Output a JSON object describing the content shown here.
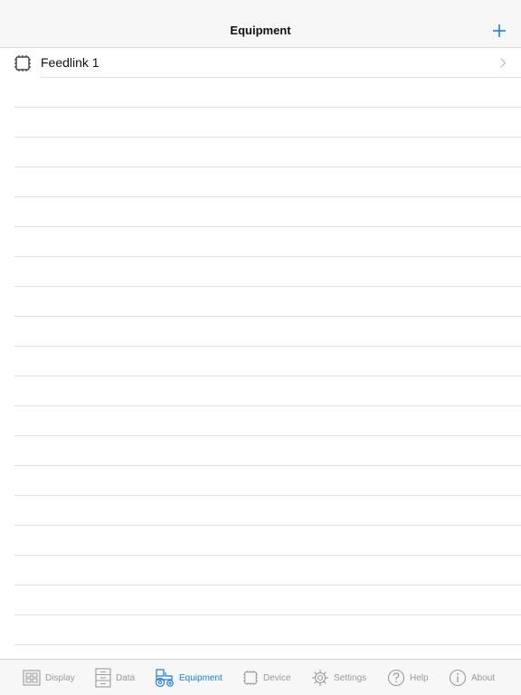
{
  "header": {
    "title": "Equipment"
  },
  "list": {
    "items": [
      {
        "label": "Feedlink 1"
      }
    ],
    "empty_row_count": 19
  },
  "tabs": [
    {
      "label": "Display",
      "icon": "display-icon",
      "active": false
    },
    {
      "label": "Data",
      "icon": "data-icon",
      "active": false
    },
    {
      "label": "Equipment",
      "icon": "tractor-icon",
      "active": true
    },
    {
      "label": "Device",
      "icon": "chip-icon",
      "active": false
    },
    {
      "label": "Settings",
      "icon": "gear-icon",
      "active": false
    },
    {
      "label": "Help",
      "icon": "help-icon",
      "active": false
    },
    {
      "label": "About",
      "icon": "info-icon",
      "active": false
    }
  ],
  "colors": {
    "accent": "#1a7fd4",
    "inactive": "#9a9a9a",
    "bar_background": "#f7f7f7",
    "separator": "#e2e2e6"
  }
}
